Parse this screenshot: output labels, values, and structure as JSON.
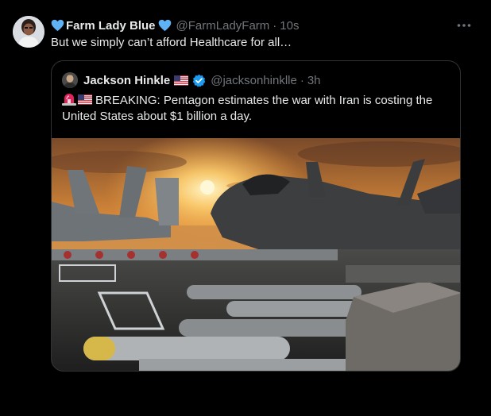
{
  "post": {
    "display_name": "Farm Lady Blue",
    "handle": "@FarmLadyFarm",
    "separator": "·",
    "time": "10s",
    "text": "But we simply can’t afford Healthcare for all…",
    "more_icon": "more-horizontal-icon"
  },
  "quoted": {
    "display_name": "Jackson Hinkle",
    "handle": "@jacksonhinklle",
    "separator": "·",
    "time": "3h",
    "flag_icon": "us-flag-icon",
    "verified_icon": "verified-badge-icon",
    "text_prefix_icons": [
      "siren-icon",
      "us-flag-icon"
    ],
    "text": "BREAKING:  Pentagon estimates the war with Iran is costing the United States about $1 billion a day.",
    "media_icon": "fighter-jets-on-carrier-image"
  },
  "colors": {
    "background": "#000000",
    "text_primary": "#e7e9ea",
    "text_secondary": "#71767b",
    "border": "#2f3336",
    "verified_blue": "#1d9bf0",
    "heart_blue": "#5fb3f5"
  }
}
